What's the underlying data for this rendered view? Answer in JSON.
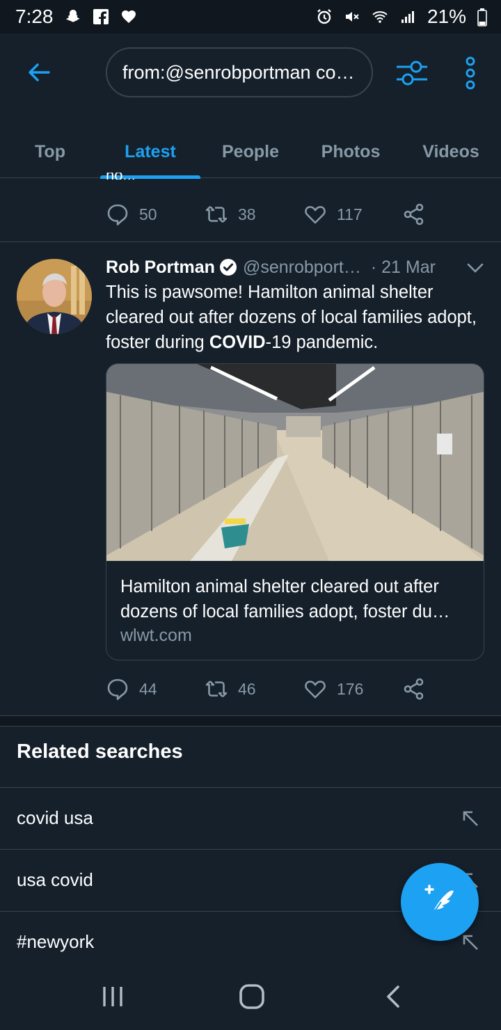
{
  "status_bar": {
    "time": "7:28",
    "battery": "21%"
  },
  "search": {
    "query": "from:@senrobportman co…"
  },
  "tabs": [
    {
      "label": "Top"
    },
    {
      "label": "Latest"
    },
    {
      "label": "People"
    },
    {
      "label": "Photos"
    },
    {
      "label": "Videos"
    }
  ],
  "previous_tweet": {
    "truncated_text": "ho...",
    "replies": "50",
    "retweets": "38",
    "likes": "117"
  },
  "tweet": {
    "author_name": "Rob Portman",
    "handle": "@senrobport…",
    "time": "· 21 Mar",
    "text_part1": "This is pawsome! Hamilton animal shelter cleared out after dozens of local families adopt, foster during ",
    "text_bold": "COVID",
    "text_part2": "-19 pandemic.",
    "card": {
      "title_line1": "Hamilton animal shelter cleared out after",
      "title_line2": "dozens of local families adopt, foster du…",
      "domain": "wlwt.com"
    },
    "replies": "44",
    "retweets": "46",
    "likes": "176"
  },
  "related": {
    "title": "Related searches",
    "items": [
      {
        "label": "covid usa"
      },
      {
        "label": "usa covid"
      },
      {
        "label": "#newyork"
      }
    ]
  },
  "colors": {
    "background": "#15202b",
    "accent": "#1da1f2",
    "secondary_text": "#8899a6",
    "border": "#38444d"
  }
}
